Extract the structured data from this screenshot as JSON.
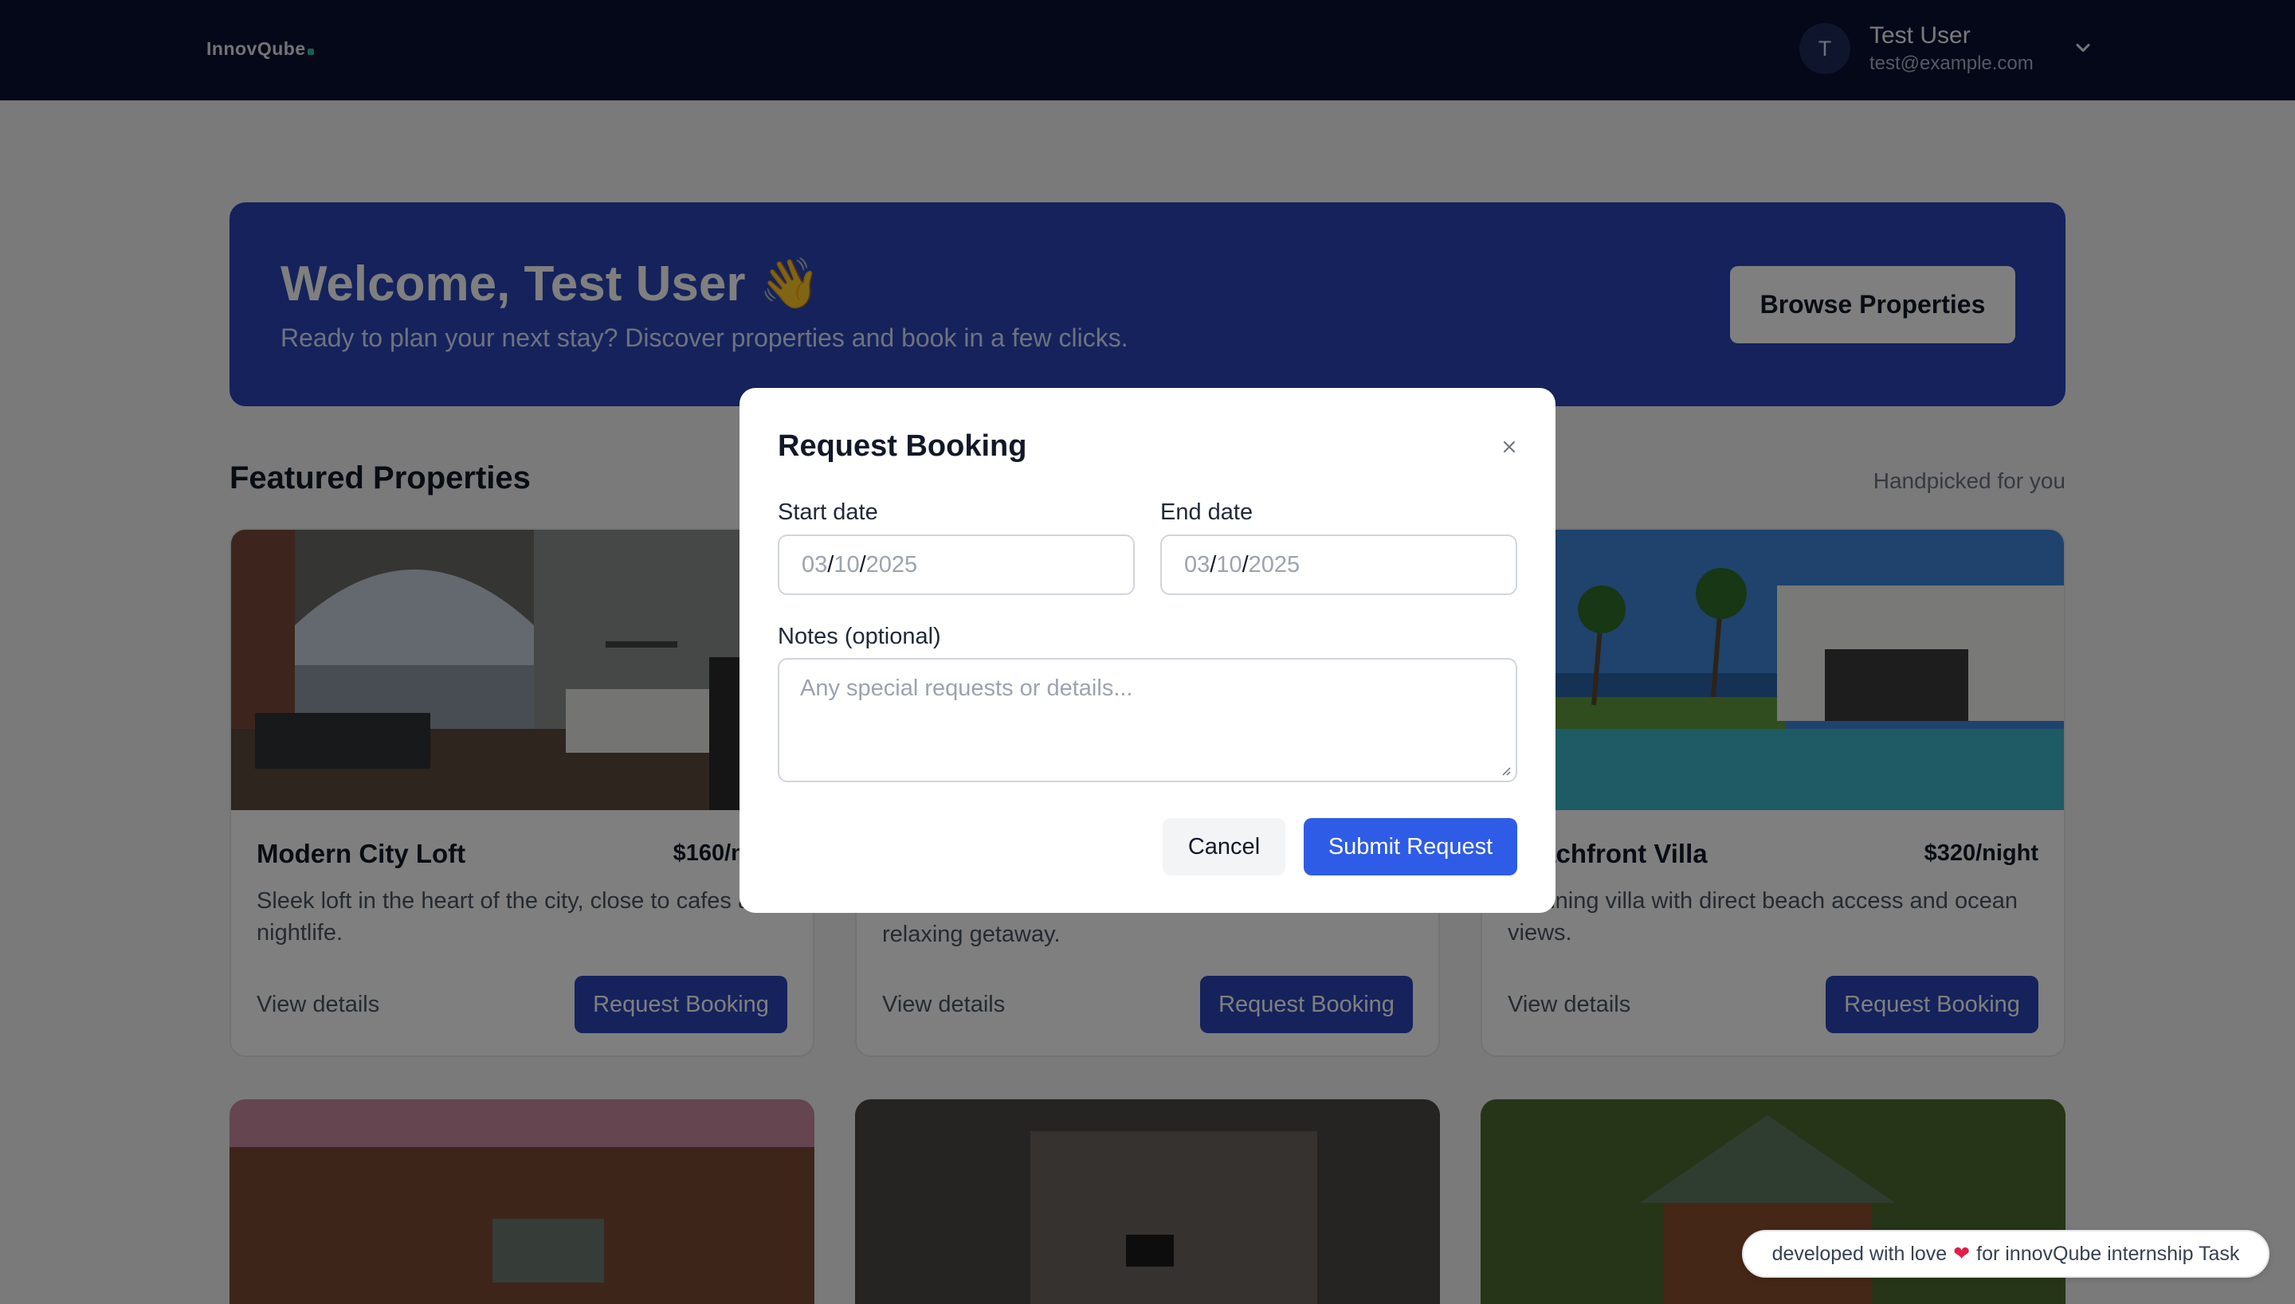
{
  "nav": {
    "logo": "InnovQube",
    "user_initial": "T",
    "user_name": "Test User",
    "user_email": "test@example.com"
  },
  "hero": {
    "title": "Welcome, Test User 👋",
    "subtitle": "Ready to plan your next stay? Discover properties and book in a few clicks.",
    "browse_label": "Browse Properties"
  },
  "featured": {
    "title": "Featured Properties",
    "hint": "Handpicked for you",
    "cards": [
      {
        "title": "Modern City Loft",
        "price": "$160/night",
        "desc": "Sleek loft in the heart of the city, close to cafes and nightlife.",
        "link": "View details",
        "button": "Request Booking"
      },
      {
        "title": "",
        "price": "",
        "desc": "relaxing getaway.",
        "link": "View details",
        "button": "Request Booking"
      },
      {
        "title": "Beachfront Villa",
        "price": "$320/night",
        "desc": "Stunning villa with direct beach access and ocean views.",
        "link": "View details",
        "button": "Request Booking"
      }
    ]
  },
  "modal": {
    "title": "Request Booking",
    "start_label": "Start date",
    "end_label": "End date",
    "start_mm": "03",
    "start_dd": "10",
    "start_yyyy": "2025",
    "end_mm": "03",
    "end_dd": "10",
    "end_yyyy": "2025",
    "date_sep": "/",
    "notes_label": "Notes (optional)",
    "notes_placeholder": "Any special requests or details...",
    "cancel_label": "Cancel",
    "submit_label": "Submit Request"
  },
  "footer": {
    "text_before": "developed with love",
    "text_after": "for innovQube internship Task"
  },
  "colors": {
    "nav_bg": "#0b1033",
    "primary": "#2b45b8",
    "submit": "#2f5ce6"
  }
}
